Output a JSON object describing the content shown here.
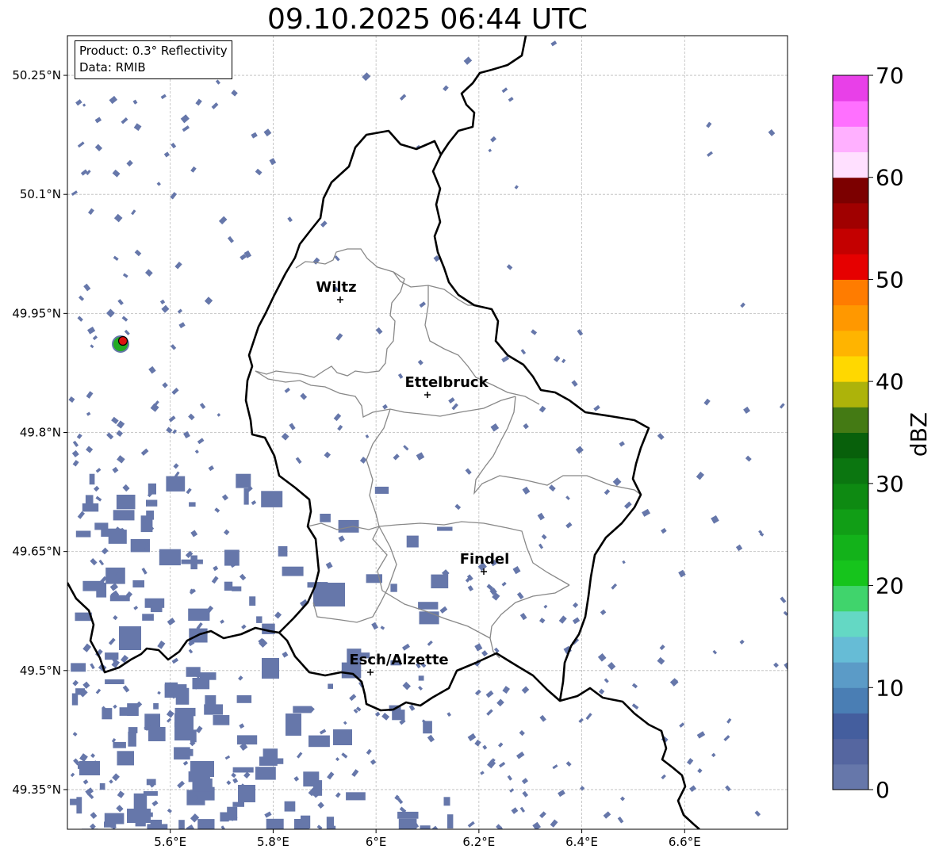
{
  "title": "09.10.2025 06:44 UTC",
  "info": {
    "product": "Product: 0.3° Reflectivity",
    "source": "Data: RMIB"
  },
  "map": {
    "lon_range": [
      5.4,
      6.8
    ],
    "lat_range": [
      49.3,
      50.3
    ],
    "lon_ticks": [
      {
        "value": 5.6,
        "label": "5.6°E"
      },
      {
        "value": 5.8,
        "label": "5.8°E"
      },
      {
        "value": 6.0,
        "label": "6°E"
      },
      {
        "value": 6.2,
        "label": "6.2°E"
      },
      {
        "value": 6.4,
        "label": "6.4°E"
      },
      {
        "value": 6.6,
        "label": "6.6°E"
      }
    ],
    "lat_ticks": [
      {
        "value": 50.25,
        "label": "50.25°N"
      },
      {
        "value": 50.1,
        "label": "50.1°N"
      },
      {
        "value": 49.95,
        "label": "49.95°N"
      },
      {
        "value": 49.8,
        "label": "49.8°N"
      },
      {
        "value": 49.65,
        "label": "49.65°N"
      },
      {
        "value": 49.5,
        "label": "49.5°N"
      },
      {
        "value": 49.35,
        "label": "49.35°N"
      }
    ],
    "cities": [
      {
        "name": "Wiltz",
        "lon": 5.93,
        "lat": 49.967
      },
      {
        "name": "Ettelbruck",
        "lon": 6.1,
        "lat": 49.847
      },
      {
        "name": "Findel",
        "lon": 6.21,
        "lat": 49.627
      },
      {
        "name": "Esch/Alzette",
        "lon": 5.99,
        "lat": 49.5
      }
    ],
    "radar_site": {
      "lon": 5.505,
      "lat": 49.914
    }
  },
  "colorbar": {
    "label": "dBZ",
    "min": 0,
    "max": 70,
    "step": 2.5,
    "ticks": [
      "0",
      "10",
      "20",
      "30",
      "40",
      "50",
      "60",
      "70"
    ],
    "colors": [
      "#6677aa",
      "#5566a0",
      "#445e9e",
      "#4a7eb4",
      "#5b9bc7",
      "#66bcd6",
      "#64d8c4",
      "#40d46c",
      "#16c41c",
      "#13b21a",
      "#119e16",
      "#0e8a12",
      "#0b7610",
      "#08600b",
      "#447a14",
      "#adb30a",
      "#ffd800",
      "#ffb400",
      "#ff9800",
      "#ff7c00",
      "#e60000",
      "#c40000",
      "#a00000",
      "#7c0000",
      "#ffe0ff",
      "#ffb0ff",
      "#ff70ff",
      "#e840e8"
    ],
    "echo_color": "#6677aa"
  }
}
